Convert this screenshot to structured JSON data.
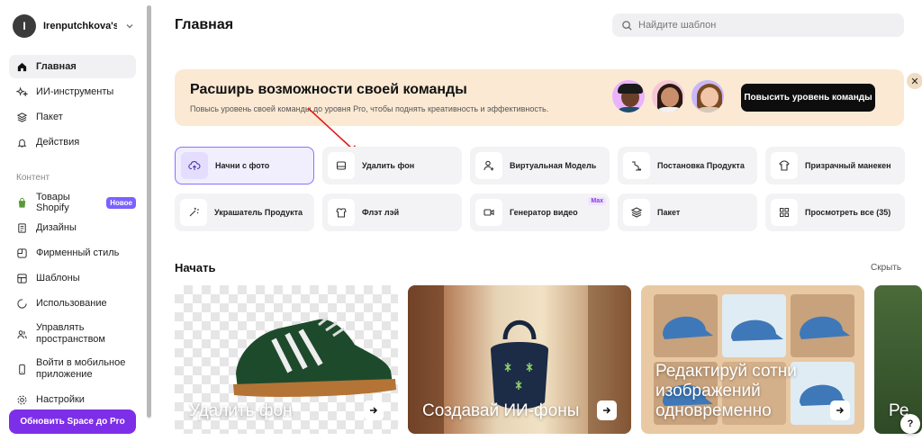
{
  "workspace": {
    "initial": "I",
    "name": "Irenputchkova's ..."
  },
  "sidebar": {
    "items": [
      {
        "label": "Главная"
      },
      {
        "label": "ИИ-инструменты"
      },
      {
        "label": "Пакет"
      },
      {
        "label": "Действия"
      }
    ],
    "section_label": "Контент",
    "content_items": [
      {
        "label": "Товары Shopify",
        "badge": "Новое"
      },
      {
        "label": "Дизайны"
      },
      {
        "label": "Фирменный стиль"
      },
      {
        "label": "Шаблоны"
      },
      {
        "label": "Использование"
      },
      {
        "label": "Управлять пространством"
      },
      {
        "label": "Войти в мобильное приложение"
      },
      {
        "label": "Настройки"
      }
    ],
    "upgrade_label": "Обновить Space до Pro"
  },
  "header": {
    "title": "Главная",
    "search_placeholder": "Найдите шаблон"
  },
  "banner": {
    "title": "Расширь возможности своей команды",
    "subtitle": "Повысь уровень своей команды до уровня Pro, чтобы поднять креативность и эффективность.",
    "button_label": "Повысить уровень команды",
    "close_glyph": "✕"
  },
  "tools": [
    {
      "label": "Начни с фото",
      "icon": "upload-cloud-icon",
      "selected": true
    },
    {
      "label": "Удалить фон",
      "icon": "remove-background-icon"
    },
    {
      "label": "Виртуальная Модель",
      "icon": "virtual-model-icon"
    },
    {
      "label": "Постановка Продукта",
      "icon": "product-staging-icon"
    },
    {
      "label": "Призрачный манекен",
      "icon": "ghost-mannequin-icon"
    },
    {
      "label": "Украшатель Продукта",
      "icon": "magic-wand-icon"
    },
    {
      "label": "Флэт лэй",
      "icon": "flat-lay-icon"
    },
    {
      "label": "Генератор видео",
      "icon": "video-icon",
      "badge": "Max"
    },
    {
      "label": "Пакет",
      "icon": "layers-icon"
    },
    {
      "label": "Просмотреть все (35)",
      "icon": "grid-icon"
    }
  ],
  "start": {
    "title": "Начать",
    "hide_label": "Скрыть",
    "cards": [
      {
        "label": "Удалить фон"
      },
      {
        "label": "Создавай ИИ-фоны"
      },
      {
        "label": "Редактируй сотни изображений одновременно"
      },
      {
        "label": "Ре"
      }
    ]
  },
  "help_glyph": "?",
  "colors": {
    "accent": "#7d2ee8",
    "banner_bg": "#fbe9d3",
    "selected_tool_border": "#8a70ff",
    "badge_new": "#7b61ff"
  }
}
